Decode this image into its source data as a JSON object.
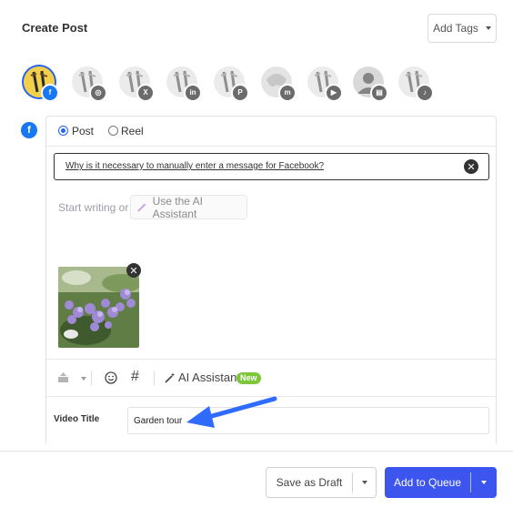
{
  "header": {
    "title": "Create Post",
    "add_tags_label": "Add Tags"
  },
  "accounts": [
    {
      "network": "facebook",
      "badge": "f",
      "selected": true
    },
    {
      "network": "instagram",
      "badge": "◎",
      "selected": false
    },
    {
      "network": "x",
      "badge": "X",
      "selected": false
    },
    {
      "network": "linkedin",
      "badge": "in",
      "selected": false
    },
    {
      "network": "pinterest",
      "badge": "P",
      "selected": false
    },
    {
      "network": "mastodon",
      "badge": "m",
      "selected": false
    },
    {
      "network": "youtube",
      "badge": "▶",
      "selected": false
    },
    {
      "network": "google-business",
      "badge": "▤",
      "selected": false
    },
    {
      "network": "tiktok",
      "badge": "♪",
      "selected": false
    }
  ],
  "editor": {
    "network_badge": "f",
    "post_type_options": [
      "Post",
      "Reel"
    ],
    "selected_post_type": "Post",
    "notice_link": "Why is it necessary to manually enter a message for Facebook?",
    "placeholder": "Start writing or",
    "ai_button_label": "Use the AI Assistant",
    "toolbar": {
      "ai_label": "AI Assistant",
      "ai_badge": "New"
    },
    "video_title_label": "Video Title",
    "video_title_value": "Garden tour"
  },
  "footer": {
    "save_draft_label": "Save as Draft",
    "add_queue_label": "Add to Queue"
  },
  "colors": {
    "primary": "#3d55ef",
    "facebook": "#1877f2",
    "badge_green": "#7cc63a",
    "annotation_arrow": "#2f6bff"
  }
}
